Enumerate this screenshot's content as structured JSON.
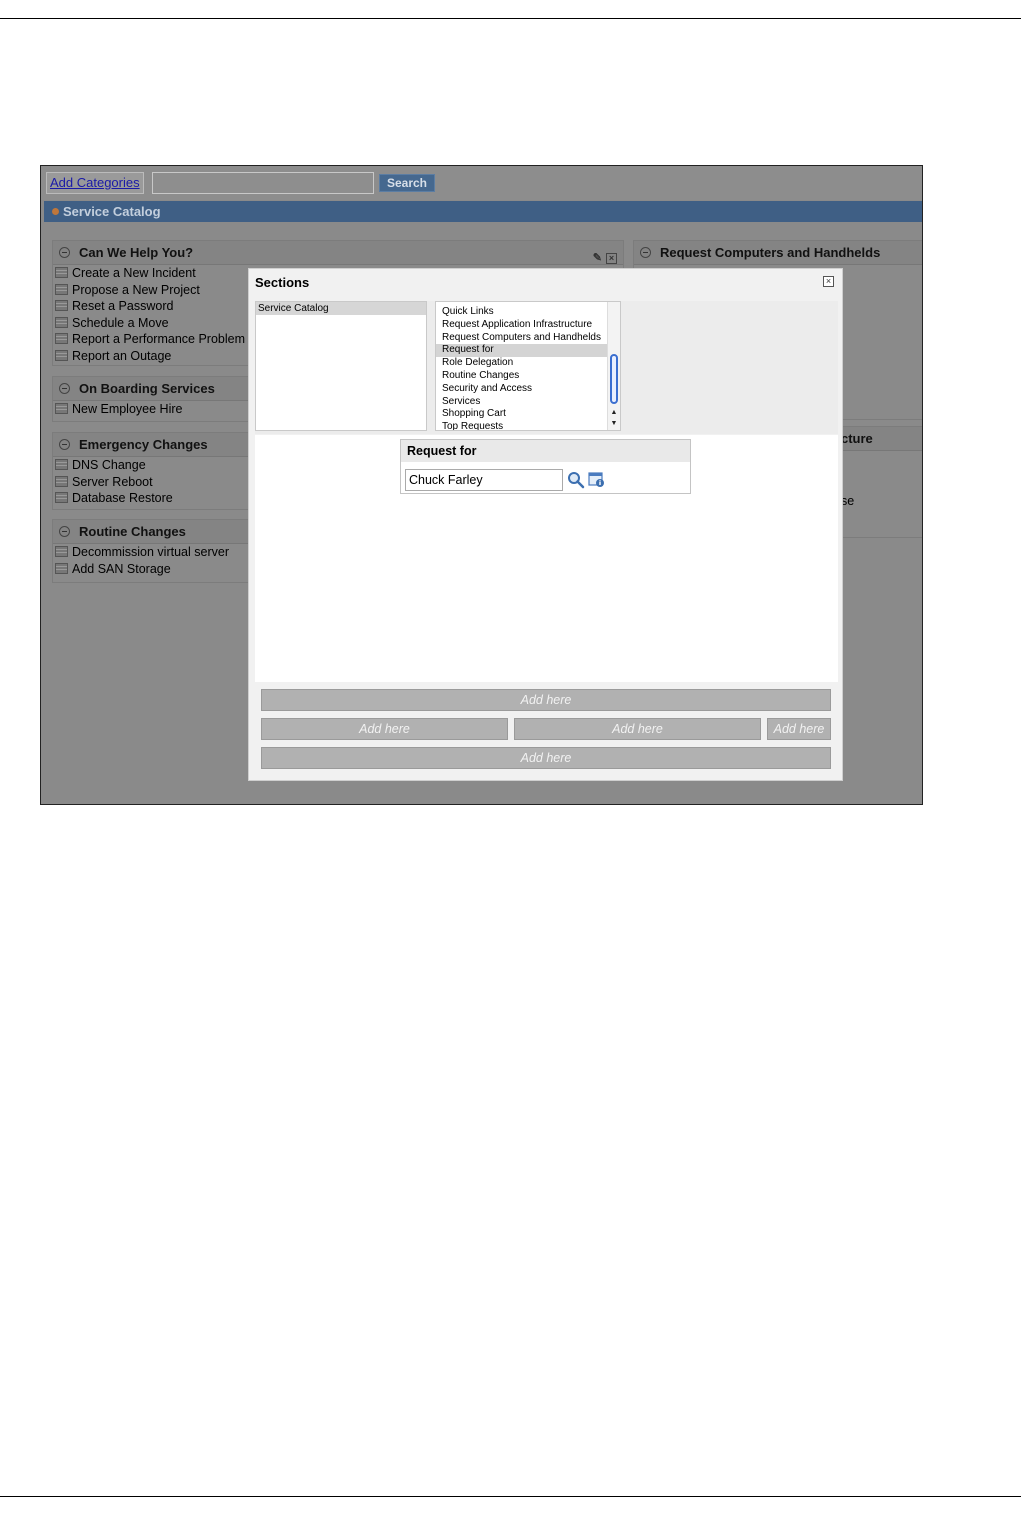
{
  "toolbar": {
    "add_categories": "Add Categories",
    "search_placeholder": "",
    "search_button": "Search"
  },
  "catalog_bar": {
    "title": "Service Catalog"
  },
  "panels": {
    "help": {
      "title": "Can We Help You?",
      "items": [
        "Create a New Incident",
        "Propose a New Project",
        "Reset a Password",
        "Schedule a Move",
        "Report a Performance Problem",
        "Report an Outage"
      ]
    },
    "onboarding": {
      "title": "On Boarding Services",
      "items": [
        "New Employee Hire"
      ]
    },
    "emergency": {
      "title": "Emergency Changes",
      "items": [
        "DNS Change",
        "Server Reboot",
        "Database Restore"
      ]
    },
    "routine": {
      "title": "Routine Changes",
      "items": [
        "Decommission virtual server",
        "Add SAN Storage"
      ]
    },
    "computers": {
      "title": "Request Computers and Handhelds"
    },
    "infrastructure_fragment": "cture",
    "se_fragment": "se"
  },
  "modal": {
    "title": "Sections",
    "left_list": [
      "Service Catalog"
    ],
    "right_list": [
      "Quick Links",
      "Request Application Infrastructure",
      "Request Computers and Handhelds",
      "Request for",
      "Role Delegation",
      "Routine Changes",
      "Security and Access",
      "Services",
      "Shopping Cart",
      "Top Requests"
    ],
    "selected_right": "Request for",
    "widget": {
      "title": "Request for",
      "input_value": "Chuck Farley"
    },
    "drop_label": "Add here"
  }
}
